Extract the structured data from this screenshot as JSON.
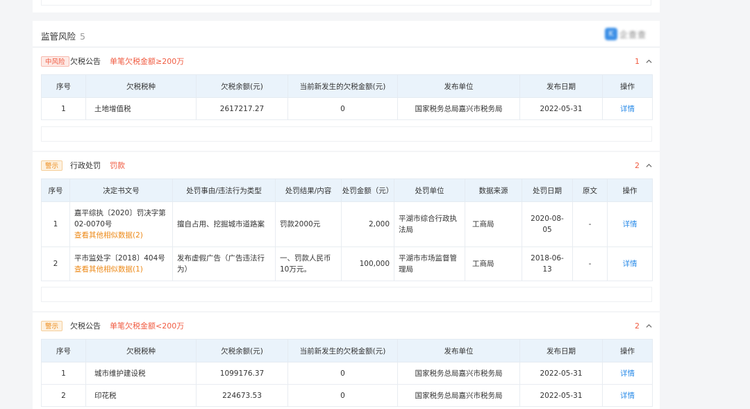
{
  "section": {
    "title": "监管风险",
    "count": "5",
    "logo_text": "企查查",
    "logo_icon": "K"
  },
  "cards": [
    {
      "badge": "中风险",
      "title": "欠税公告",
      "subtitle": "单笔欠税金额≥200万",
      "count": "1",
      "headers": [
        "序号",
        "欠税税种",
        "欠税余额(元)",
        "当前新发生的欠税金额(元)",
        "发布单位",
        "发布日期",
        "操作"
      ],
      "rows": [
        [
          "1",
          "土地增值税",
          "2617217.27",
          "0",
          "国家税务总局嘉兴市税务局",
          "2022-05-31",
          "详情"
        ]
      ]
    },
    {
      "badge": "警示",
      "title": "行政处罚",
      "subtitle": "罚款",
      "count": "2",
      "headers": [
        "序号",
        "决定书文号",
        "处罚事由/违法行为类型",
        "处罚结果/内容",
        "处罚金额（元）",
        "处罚单位",
        "数据来源",
        "处罚日期",
        "原文",
        "操作"
      ],
      "rows": [
        {
          "no": "1",
          "doc": "嘉平综执〔2020〕罚决字第02-0070号",
          "similar": "查看其他相似数据(2)",
          "reason": "擅自占用、挖掘城市道路案",
          "result": "罚款2000元",
          "amount": "2,000",
          "unit": "平湖市综合行政执法局",
          "source": "工商局",
          "date": "2020-08-05",
          "original": "-",
          "action": "详情"
        },
        {
          "no": "2",
          "doc": "平市监处字〔2018〕404号",
          "similar": "查看其他相似数据(1)",
          "reason": "发布虚假广告（广告违法行为）",
          "result": "一、罚款人民币10万元。",
          "amount": "100,000",
          "unit": "平湖市市场监督管理局",
          "source": "工商局",
          "date": "2018-06-13",
          "original": "-",
          "action": "详情"
        }
      ]
    },
    {
      "badge": "警示",
      "title": "欠税公告",
      "subtitle": "单笔欠税金额<200万",
      "count": "2",
      "headers": [
        "序号",
        "欠税税种",
        "欠税余额(元)",
        "当前新发生的欠税金额(元)",
        "发布单位",
        "发布日期",
        "操作"
      ],
      "rows": [
        [
          "1",
          "城市维护建设税",
          "1099176.37",
          "0",
          "国家税务总局嘉兴市税务局",
          "2022-05-31",
          "详情"
        ],
        [
          "2",
          "印花税",
          "224673.53",
          "0",
          "国家税务总局嘉兴市税务局",
          "2022-05-31",
          "详情"
        ]
      ]
    }
  ]
}
